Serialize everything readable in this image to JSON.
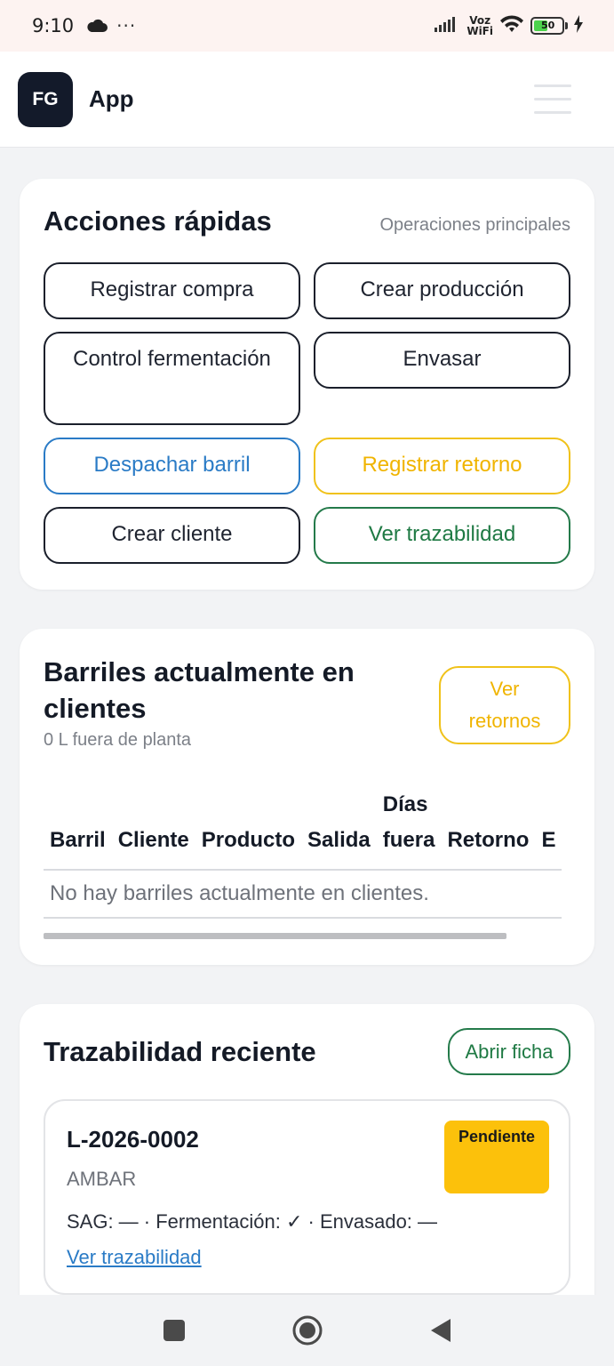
{
  "status_bar": {
    "time": "9:10",
    "dots": "···",
    "voz": "Voz",
    "wifi_label": "WiFi",
    "battery": "50",
    "battery_level": 0.5
  },
  "app_bar": {
    "logo_text": "FG",
    "title": "App"
  },
  "quick_actions": {
    "title": "Acciones rápidas",
    "subtitle": "Operaciones principales",
    "buttons": {
      "registrar_compra": "Registrar compra",
      "crear_produccion": "Crear producción",
      "control_fermentacion": "Control fermentación",
      "envasar": "Envasar",
      "despachar_barril": "Despachar barril",
      "registrar_retorno": "Registrar retorno",
      "crear_cliente": "Crear cliente",
      "ver_trazabilidad": "Ver trazabilidad"
    }
  },
  "barrels": {
    "title": "Barriles actualmente en clientes",
    "subtitle": "0 L fuera de planta",
    "ver_retornos": "Ver retornos",
    "table": {
      "headers": {
        "barril": "Barril",
        "cliente": "Cliente",
        "producto": "Producto",
        "salida": "Salida",
        "dias_fuera": "Días fuera",
        "retorno": "Retorno",
        "estado": "E"
      },
      "empty": "No hay barriles actualmente en clientes."
    }
  },
  "traceability": {
    "title": "Trazabilidad reciente",
    "open_button": "Abrir ficha",
    "items": [
      {
        "lot": "L-2026-0002",
        "style": "AMBAR",
        "badge": "Pendiente",
        "flags": "SAG: — · Fermentación: ✓ · Envasado: —",
        "link": "Ver trazabilidad"
      }
    ]
  },
  "colors": {
    "primary_dark": "#131a2a",
    "blue": "#2a7bc6",
    "yellow": "#f0c21a",
    "green": "#247a4a",
    "badge_yellow": "#fcc10b"
  },
  "icons": [
    "cloud-icon",
    "signal-icon",
    "wifi-icon",
    "battery-icon",
    "charging-icon",
    "menu-icon",
    "square-nav-icon",
    "home-nav-icon",
    "back-nav-icon"
  ]
}
